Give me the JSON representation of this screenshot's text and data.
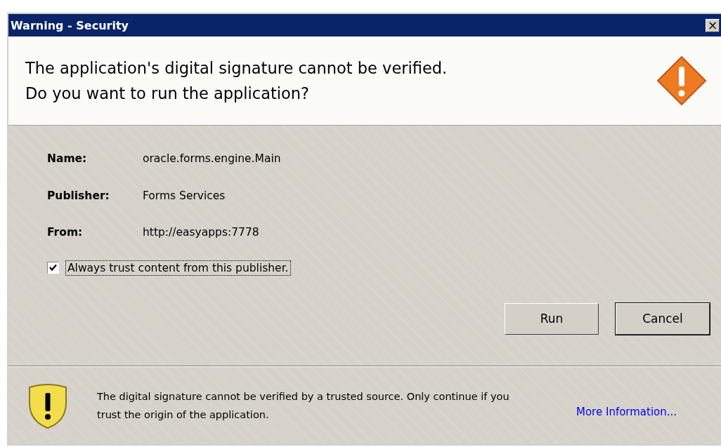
{
  "window": {
    "title": "Warning - Security",
    "close": "×"
  },
  "header": {
    "lines": [
      "The application's digital signature cannot be verified.",
      "Do you want to run the application?"
    ]
  },
  "details": [
    {
      "label": "Name:",
      "value": "oracle.forms.engine.Main"
    },
    {
      "label": "Publisher:",
      "value": "Forms Services"
    },
    {
      "label": "From:",
      "value": "http://easyapps:7778"
    }
  ],
  "trust": {
    "label": "Always trust content from this publisher.",
    "checked": true
  },
  "buttons": [
    {
      "label": "Run",
      "default": false
    },
    {
      "label": "Cancel",
      "default": true
    }
  ],
  "footer": {
    "message": "The digital signature cannot be verified by a trusted source.  Only continue if you trust the origin of the application.",
    "link": "More Information..."
  }
}
